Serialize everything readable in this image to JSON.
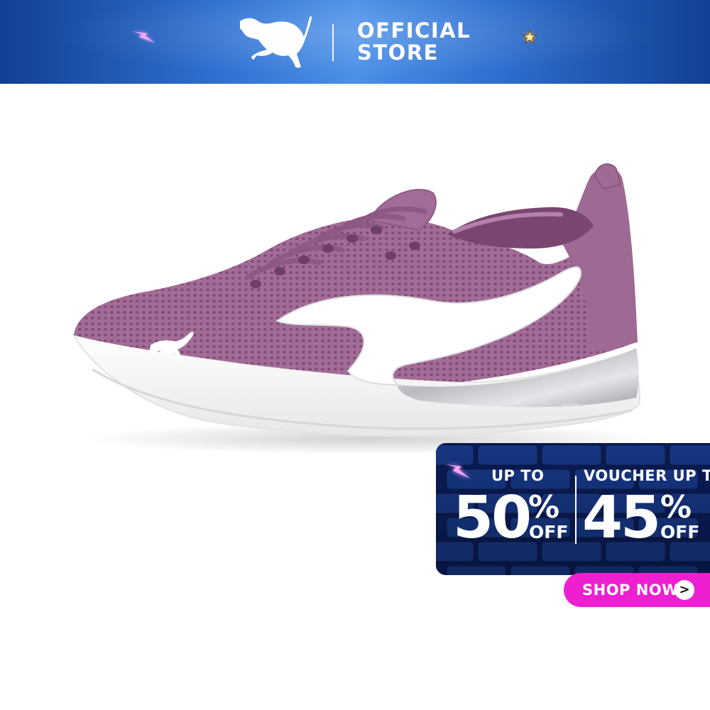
{
  "header": {
    "brand": "PUMA",
    "store_line1": "OFFICIAL",
    "store_line2": "STORE",
    "logo_icon": "puma-cat-logo-icon",
    "decor_left_icon": "lightning-spark-icon",
    "decor_right_icon": "star-icon"
  },
  "product": {
    "image": "pink-purple-running-sneaker"
  },
  "promo": {
    "left": {
      "caption": "UP TO",
      "value": "50",
      "percent": "%",
      "off": "OFF"
    },
    "right": {
      "caption": "VOUCHER UP TO",
      "value": "45",
      "percent": "%",
      "off": "OFF"
    }
  },
  "cta": {
    "label": "SHOP NOW",
    "arrow": ">"
  },
  "colors": {
    "banner_blue": "#2d6fd0",
    "promo_navy": "#0b1f5c",
    "cta_magenta": "#ee1fd0",
    "shoe_mauve": "#a8719a"
  }
}
